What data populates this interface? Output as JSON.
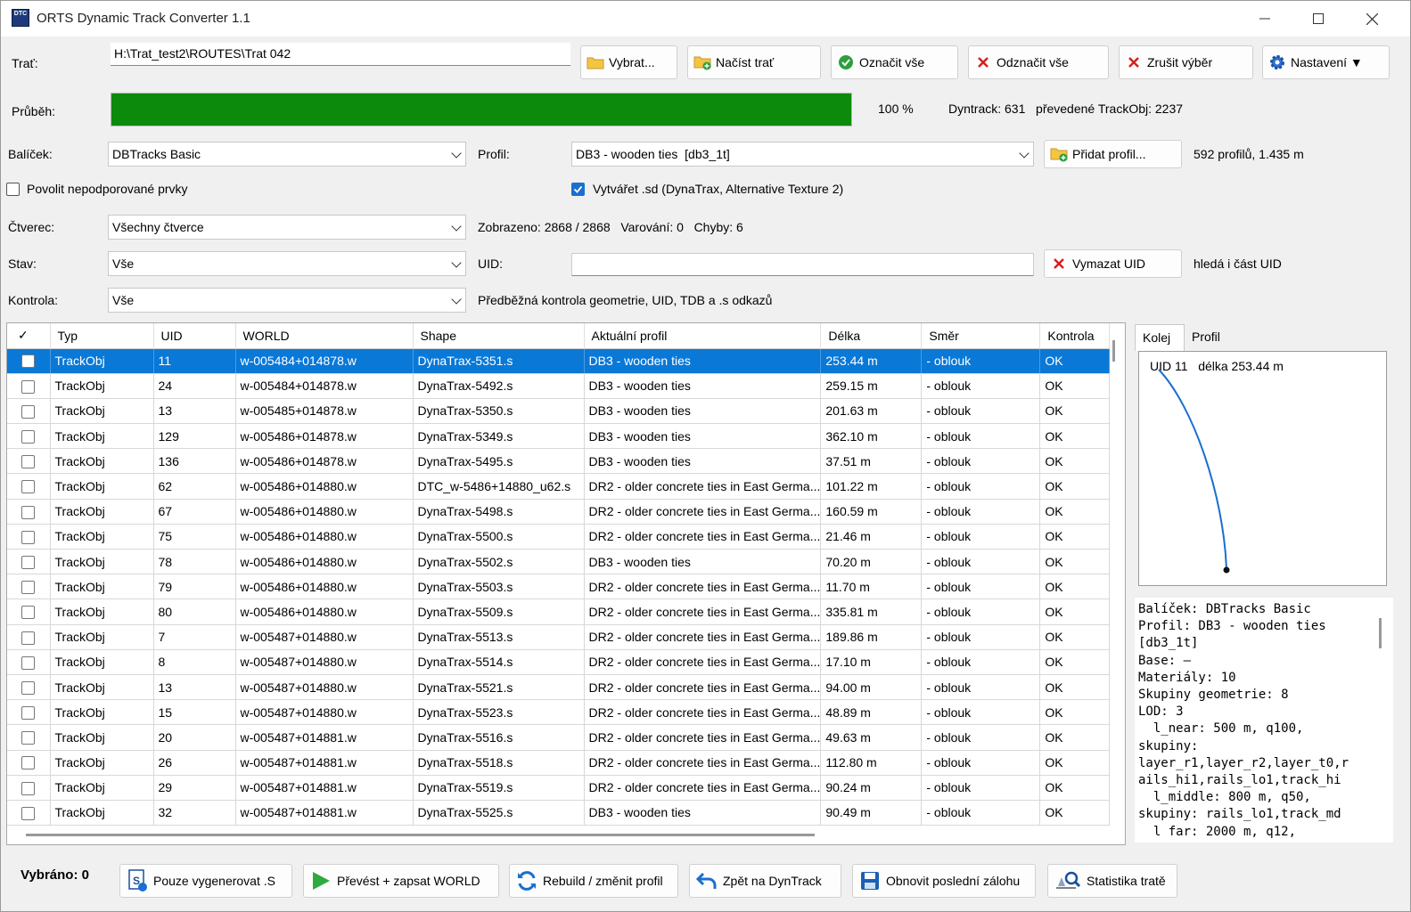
{
  "window": {
    "title": "ORTS Dynamic Track Converter 1.1",
    "icon_text": "DTC",
    "minimize_icon": "minimize-icon",
    "maximize_icon": "maximize-icon",
    "close_icon": "close-icon"
  },
  "route": {
    "label": "Trať:",
    "path": "H:\\Trat_test2\\ROUTES\\Trat 042"
  },
  "toolbar": {
    "select": "Vybrat...",
    "load": "Načíst trať",
    "check_all": "Označit vše",
    "uncheck_all": "Odznačit vše",
    "cancel_selection": "Zrušit výběr",
    "settings": "Nastavení ▼"
  },
  "progress": {
    "label": "Průběh:",
    "value": 100,
    "percent_text": "100 %",
    "stats_text": "Dyntrack: 631   převedené TrackObj: 2237",
    "fill_color": "#0b8a0b"
  },
  "package": {
    "label": "Balíček:",
    "value": "DBTracks Basic"
  },
  "profile": {
    "label": "Profil:",
    "value": "DB3 - wooden ties  [db3_1t]",
    "add_button": "Přidat profil...",
    "summary": "592 profilů, 1.435 m"
  },
  "options": {
    "allow_unsupported": "Povolit nepodporované prvky",
    "allow_unsupported_checked": false,
    "create_sd": "Vytvářet .sd (DynaTrax, Alternative Texture 2)",
    "create_sd_checked": true
  },
  "square": {
    "label": "Čtverec:",
    "value": "Všechny čtverce",
    "summary": "Zobrazeno: 2868 / 2868   Varování: 0   Chyby: 6"
  },
  "state": {
    "label": "Stav:",
    "value": "Vše"
  },
  "uid": {
    "label": "UID:",
    "value": "",
    "clear_button": "Vymazat UID",
    "hint": "hledá i část UID"
  },
  "check": {
    "label": "Kontrola:",
    "value": "Vše",
    "description": "Předběžná kontrola geometrie, UID, TDB a .s odkazů"
  },
  "table": {
    "columns": [
      "✓",
      "Typ",
      "UID",
      "WORLD",
      "Shape",
      "Aktuální profil",
      "Délka",
      "Směr",
      "Kontrola"
    ],
    "rows": [
      [
        "",
        "TrackObj",
        "11",
        "w-005484+014878.w",
        "DynaTrax-5351.s",
        "DB3 - wooden ties",
        "253.44 m",
        "- oblouk",
        "OK"
      ],
      [
        "",
        "TrackObj",
        "24",
        "w-005484+014878.w",
        "DynaTrax-5492.s",
        "DB3 - wooden ties",
        "259.15 m",
        "- oblouk",
        "OK"
      ],
      [
        "",
        "TrackObj",
        "13",
        "w-005485+014878.w",
        "DynaTrax-5350.s",
        "DB3 - wooden ties",
        "201.63 m",
        "- oblouk",
        "OK"
      ],
      [
        "",
        "TrackObj",
        "129",
        "w-005486+014878.w",
        "DynaTrax-5349.s",
        "DB3 - wooden ties",
        "362.10 m",
        "- oblouk",
        "OK"
      ],
      [
        "",
        "TrackObj",
        "136",
        "w-005486+014878.w",
        "DynaTrax-5495.s",
        "DB3 - wooden ties",
        "37.51 m",
        "- oblouk",
        "OK"
      ],
      [
        "",
        "TrackObj",
        "62",
        "w-005486+014880.w",
        "DTC_w-5486+14880_u62.s",
        "DR2 - older concrete ties in East Germa...",
        "101.22 m",
        "- oblouk",
        "OK"
      ],
      [
        "",
        "TrackObj",
        "67",
        "w-005486+014880.w",
        "DynaTrax-5498.s",
        "DR2 - older concrete ties in East Germa...",
        "160.59 m",
        "- oblouk",
        "OK"
      ],
      [
        "",
        "TrackObj",
        "75",
        "w-005486+014880.w",
        "DynaTrax-5500.s",
        "DR2 - older concrete ties in East Germa...",
        "21.46 m",
        "- oblouk",
        "OK"
      ],
      [
        "",
        "TrackObj",
        "78",
        "w-005486+014880.w",
        "DynaTrax-5502.s",
        "DB3 - wooden ties",
        "70.20 m",
        "- oblouk",
        "OK"
      ],
      [
        "",
        "TrackObj",
        "79",
        "w-005486+014880.w",
        "DynaTrax-5503.s",
        "DR2 - older concrete ties in East Germa...",
        "11.70 m",
        "- oblouk",
        "OK"
      ],
      [
        "",
        "TrackObj",
        "80",
        "w-005486+014880.w",
        "DynaTrax-5509.s",
        "DR2 - older concrete ties in East Germa...",
        "335.81 m",
        "- oblouk",
        "OK"
      ],
      [
        "",
        "TrackObj",
        "7",
        "w-005487+014880.w",
        "DynaTrax-5513.s",
        "DR2 - older concrete ties in East Germa...",
        "189.86 m",
        "- oblouk",
        "OK"
      ],
      [
        "",
        "TrackObj",
        "8",
        "w-005487+014880.w",
        "DynaTrax-5514.s",
        "DR2 - older concrete ties in East Germa...",
        "17.10 m",
        "- oblouk",
        "OK"
      ],
      [
        "",
        "TrackObj",
        "13",
        "w-005487+014880.w",
        "DynaTrax-5521.s",
        "DR2 - older concrete ties in East Germa...",
        "94.00 m",
        "- oblouk",
        "OK"
      ],
      [
        "",
        "TrackObj",
        "15",
        "w-005487+014880.w",
        "DynaTrax-5523.s",
        "DR2 - older concrete ties in East Germa...",
        "48.89 m",
        "- oblouk",
        "OK"
      ],
      [
        "",
        "TrackObj",
        "20",
        "w-005487+014881.w",
        "DynaTrax-5516.s",
        "DR2 - older concrete ties in East Germa...",
        "49.63 m",
        "- oblouk",
        "OK"
      ],
      [
        "",
        "TrackObj",
        "26",
        "w-005487+014881.w",
        "DynaTrax-5518.s",
        "DR2 - older concrete ties in East Germa...",
        "112.80 m",
        "- oblouk",
        "OK"
      ],
      [
        "",
        "TrackObj",
        "29",
        "w-005487+014881.w",
        "DynaTrax-5519.s",
        "DR2 - older concrete ties in East Germa...",
        "90.24 m",
        "- oblouk",
        "OK"
      ],
      [
        "",
        "TrackObj",
        "32",
        "w-005487+014881.w",
        "DynaTrax-5525.s",
        "DB3 - wooden ties",
        "90.49 m",
        "- oblouk",
        "OK"
      ]
    ],
    "selected_row": 0,
    "selection_color": "#0a78d7"
  },
  "side_panel": {
    "tab_track": "Kolej",
    "tab_profile": "Profil",
    "active_tab": "Kolej",
    "preview_caption": "UID 11   délka 253.44 m",
    "curve_color": "#1a6fd0",
    "info_lines": [
      "Balíček: DBTracks Basic",
      "Profil: DB3 - wooden ties",
      "[db3_1t]",
      "Base: —",
      "Materiály: 10",
      "Skupiny geometrie: 8",
      "LOD: 3",
      "  l_near: 500 m, q100,",
      "skupiny:",
      "layer_r1,layer_r2,layer_t0,r",
      "ails_hi1,rails_lo1,track_hi",
      "  l_middle: 800 m, q50,",
      "skupiny: rails_lo1,track_md",
      "  l far: 2000 m, q12,"
    ]
  },
  "bottom": {
    "selected_label": "Vybráno: 0",
    "generate_s": "Pouze vygenerovat .S",
    "convert_write": "Převést + zapsat WORLD",
    "rebuild": "Rebuild / změnit profil",
    "back_dyntrack": "Zpět na DynTrack",
    "restore_backup": "Obnovit poslední zálohu",
    "statistics": "Statistika tratě"
  }
}
